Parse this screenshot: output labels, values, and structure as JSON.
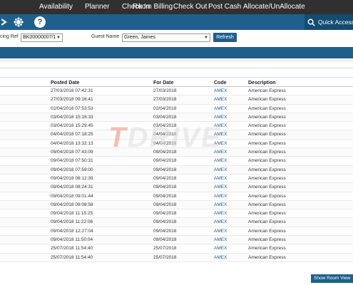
{
  "nav": {
    "items": [
      "Availability",
      "Planner",
      "Check In",
      "Room Billing",
      "Check Out",
      "Post Cash",
      "Allocate/UnAllocate"
    ]
  },
  "toolbar": {
    "icons": [
      "people-icon",
      "gear-icon",
      "help-icon"
    ],
    "help_glyph": "?",
    "quick_access_label": "Quick Access"
  },
  "filter": {
    "booking_ref_label": "cing Ref",
    "booking_ref_value": "BK00000007/1",
    "guest_name_label": "Guest Name",
    "guest_name_value": "Green, James",
    "refresh_label": "Refresh"
  },
  "table": {
    "headers": [
      "Posted Date",
      "For Date",
      "Code",
      "Description"
    ],
    "rows": [
      [
        "27/03/2018 07:42:31",
        "27/03/2018",
        "AMEX",
        "American Express"
      ],
      [
        "27/03/2018 09:16:41",
        "27/03/2018",
        "AMEX",
        "American Express"
      ],
      [
        "02/04/2018 07:53:53",
        "02/04/2018",
        "AMEX",
        "American Express"
      ],
      [
        "03/04/2018 15:16:33",
        "03/04/2018",
        "AMEX",
        "American Express"
      ],
      [
        "03/04/2018 15:29:45",
        "03/04/2018",
        "AMEX",
        "American Express"
      ],
      [
        "04/04/2018 07:18:25",
        "04/04/2018",
        "AMEX",
        "American Express"
      ],
      [
        "04/04/2018 13:32:13",
        "04/04/2018",
        "AMEX",
        "American Express"
      ],
      [
        "09/04/2018 07:43:09",
        "09/04/2018",
        "AMEX",
        "American Express"
      ],
      [
        "09/04/2018 07:50:31",
        "09/04/2018",
        "AMEX",
        "American Express"
      ],
      [
        "09/04/2018 07:59:00",
        "09/04/2018",
        "AMEX",
        "American Express"
      ],
      [
        "09/04/2018 08:12:39",
        "09/04/2018",
        "AMEX",
        "American Express"
      ],
      [
        "09/04/2018 08:24:31",
        "09/04/2018",
        "AMEX",
        "American Express"
      ],
      [
        "09/04/2018 09:01:44",
        "09/04/2018",
        "AMEX",
        "American Express"
      ],
      [
        "09/04/2018 09:08:58",
        "09/04/2018",
        "AMEX",
        "American Express"
      ],
      [
        "09/04/2018 11:15:25",
        "09/04/2018",
        "AMEX",
        "American Express"
      ],
      [
        "09/04/2018 11:22:06",
        "09/04/2018",
        "AMEX",
        "American Express"
      ],
      [
        "09/04/2018 12:27:04",
        "09/04/2018",
        "AMEX",
        "American Express"
      ],
      [
        "09/04/2018 11:50:04",
        "09/04/2018",
        "AMEX",
        "American Express"
      ],
      [
        "25/07/2018 11:54:40",
        "25/07/2018",
        "AMEX",
        "American Express"
      ],
      [
        "25/07/2018 11:54:40",
        "25/07/2018",
        "AMEX",
        "American Express"
      ]
    ]
  },
  "watermark": {
    "text_accent": "T",
    "text_rest": "DRIVE"
  },
  "footer": {
    "show_room_view_label": "Show Room View"
  },
  "colors": {
    "nav_bg": "#303030",
    "toolbar_bg": "#1f5f8b",
    "link": "#1f5f8b"
  }
}
